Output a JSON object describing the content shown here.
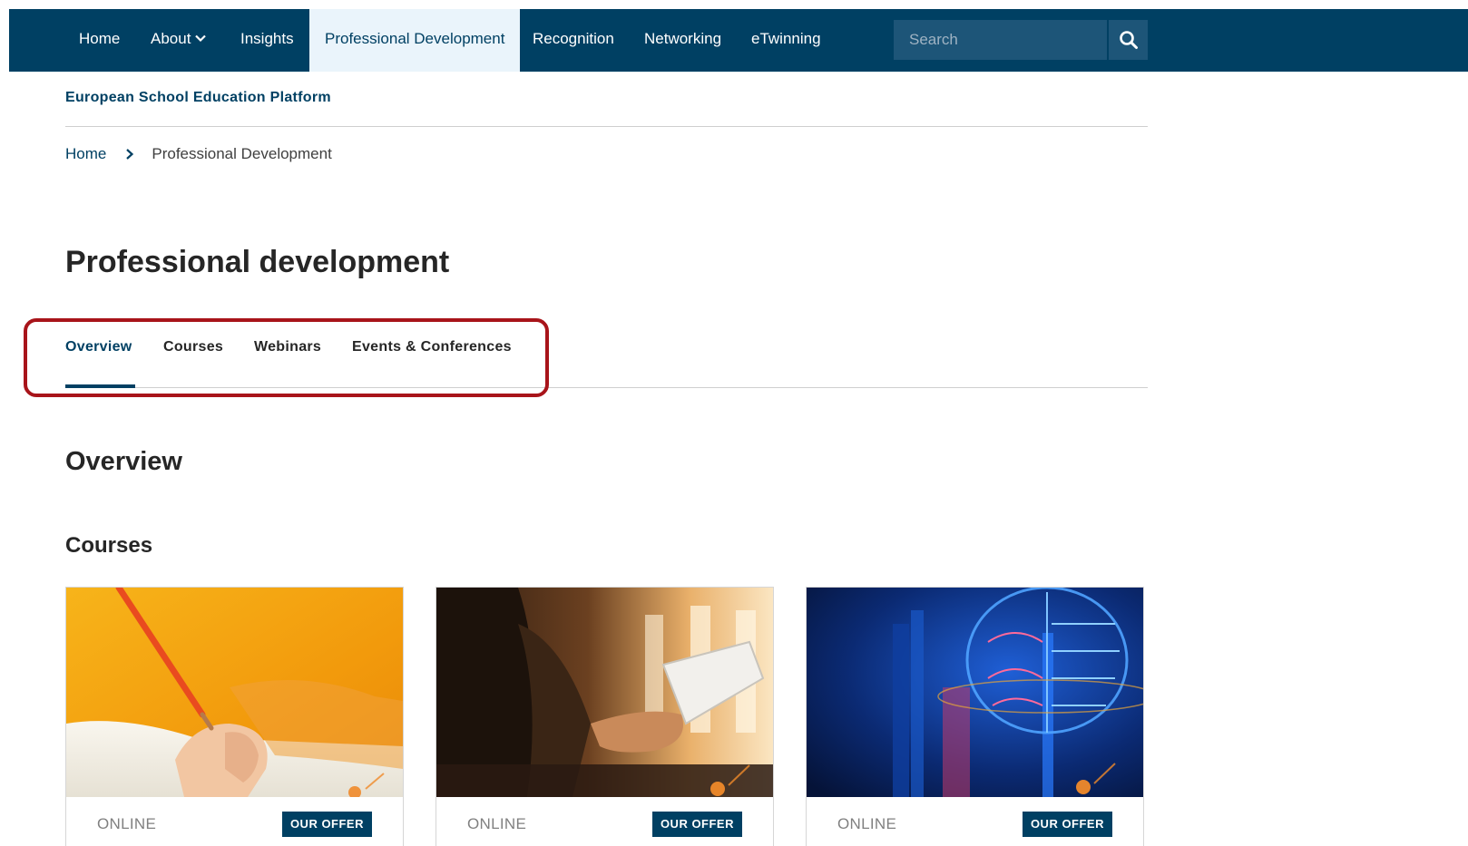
{
  "nav": {
    "items": [
      {
        "label": "Home"
      },
      {
        "label": "About"
      },
      {
        "label": "Insights"
      },
      {
        "label": "Professional Development"
      },
      {
        "label": "Recognition"
      },
      {
        "label": "Networking"
      },
      {
        "label": "eTwinning"
      }
    ],
    "active_index": 3,
    "search_placeholder": "Search"
  },
  "header": {
    "site_name": "European School Education Platform"
  },
  "breadcrumb": {
    "home": "Home",
    "current": "Professional Development"
  },
  "page": {
    "title": "Professional development",
    "tabs": [
      {
        "label": "Overview",
        "active": true
      },
      {
        "label": "Courses"
      },
      {
        "label": "Webinars"
      },
      {
        "label": "Events & Conferences"
      }
    ],
    "section_title": "Overview",
    "subsection_title": "Courses"
  },
  "cards": [
    {
      "tag": "ONLINE",
      "button": "OUR OFFER",
      "image": "student-writing-with-orange-pencil"
    },
    {
      "tag": "ONLINE",
      "button": "OUR OFFER",
      "image": "person-using-tablet-by-window"
    },
    {
      "tag": "ONLINE",
      "button": "OUR OFFER",
      "image": "digital-brain-blue-book"
    }
  ],
  "colors": {
    "primary": "#004063",
    "active_nav_bg": "#eaf4fb",
    "highlight": "#a8141a"
  }
}
